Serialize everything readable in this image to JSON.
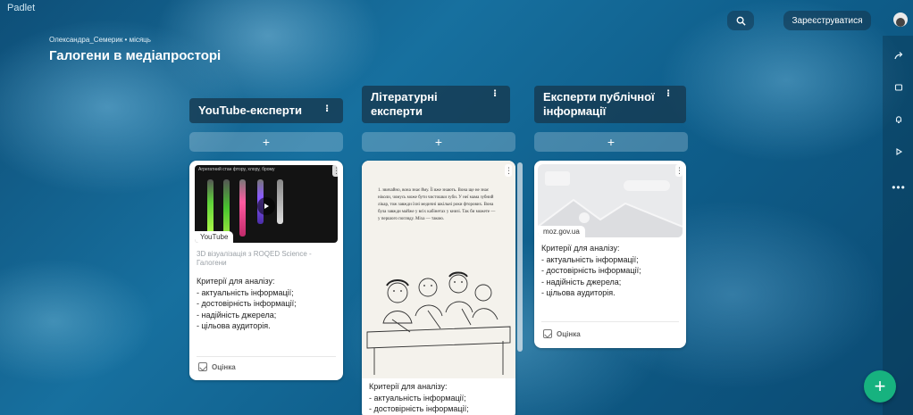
{
  "app": {
    "logo": "Padlet"
  },
  "board": {
    "author": "Олександра_Семерик • місяць",
    "title": "Галогени в медіапросторі"
  },
  "topbar": {
    "register_label": "Зареєструватися",
    "search_icon": "search-icon"
  },
  "rail": {
    "icons": [
      "share-icon",
      "remix-icon",
      "bell-icon",
      "play-icon",
      "more-icon"
    ]
  },
  "columns": [
    {
      "title": "YouTube-експерти",
      "card": {
        "video_header": "Агрегатний стан фтору, хлору, брому",
        "badge": "YouTube",
        "caption": "3D візуалізація з ROQED Science - Галогени",
        "lines": [
          "Критерії для аналізу:",
          "- актуальність інформації;",
          "- достовірність інформації;",
          "- надійність джерела;",
          "- цільова аудиторія."
        ],
        "rating_label": "Оцінка"
      }
    },
    {
      "title": "Літературні експерти",
      "card": {
        "book_text": "1. звичайно, вона знає йму. Її вже знають. Вона ще не знає ніколи, чомусь може бути чистошки зуби. У неї мама зубний лікар, тож завжди їхні медичні шкільні роки фторових. Вона була завжди майже у всіх кабінетах у книзі. Так би можете — у першого погляду. Міха — такою.",
        "lines": [
          "Критерії для аналізу:",
          "- актуальність інформації;",
          "- достовірність інформації;"
        ]
      }
    },
    {
      "title": "Експерти публічної інформації",
      "card": {
        "source": "moz.gov.ua",
        "lines": [
          "Критерії для аналізу:",
          "- актуальність інформації;",
          "- достовірність інформації;",
          "- надійність джерела;",
          "- цільова аудиторія."
        ],
        "rating_label": "Оцінка"
      }
    }
  ],
  "colors": {
    "fab": "#17b27f",
    "header": "#163a52"
  }
}
